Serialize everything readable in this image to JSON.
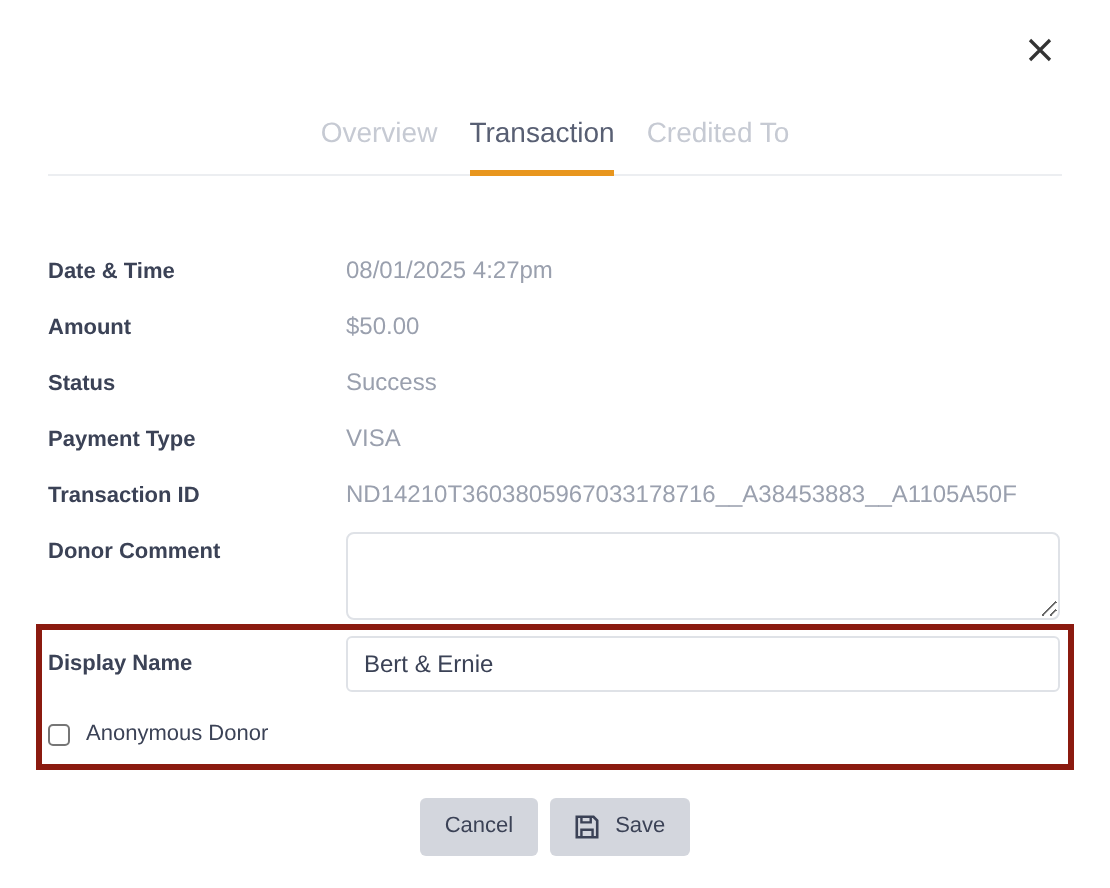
{
  "tabs": [
    {
      "label": "Overview",
      "selected": false
    },
    {
      "label": "Transaction",
      "selected": true
    },
    {
      "label": "Credited To",
      "selected": false
    }
  ],
  "details": [
    {
      "label": "Date & Time",
      "value": "08/01/2025 4:27pm"
    },
    {
      "label": "Amount",
      "value": "$50.00"
    },
    {
      "label": "Status",
      "value": "Success"
    },
    {
      "label": "Payment Type",
      "value": "VISA"
    },
    {
      "label": "Transaction ID",
      "value": "ND14210T3603805967033178716__A38453883__A1105A50F"
    }
  ],
  "donor_comment": {
    "label": "Donor Comment"
  },
  "display_name": {
    "label": "Display Name",
    "value": "Bert & Ernie"
  },
  "anonymous_donor": {
    "label": "Anonymous Donor",
    "checked": false
  },
  "buttons": [
    {
      "label": "Cancel",
      "kind": "plain"
    },
    {
      "label": "Save",
      "kind": "save"
    }
  ]
}
